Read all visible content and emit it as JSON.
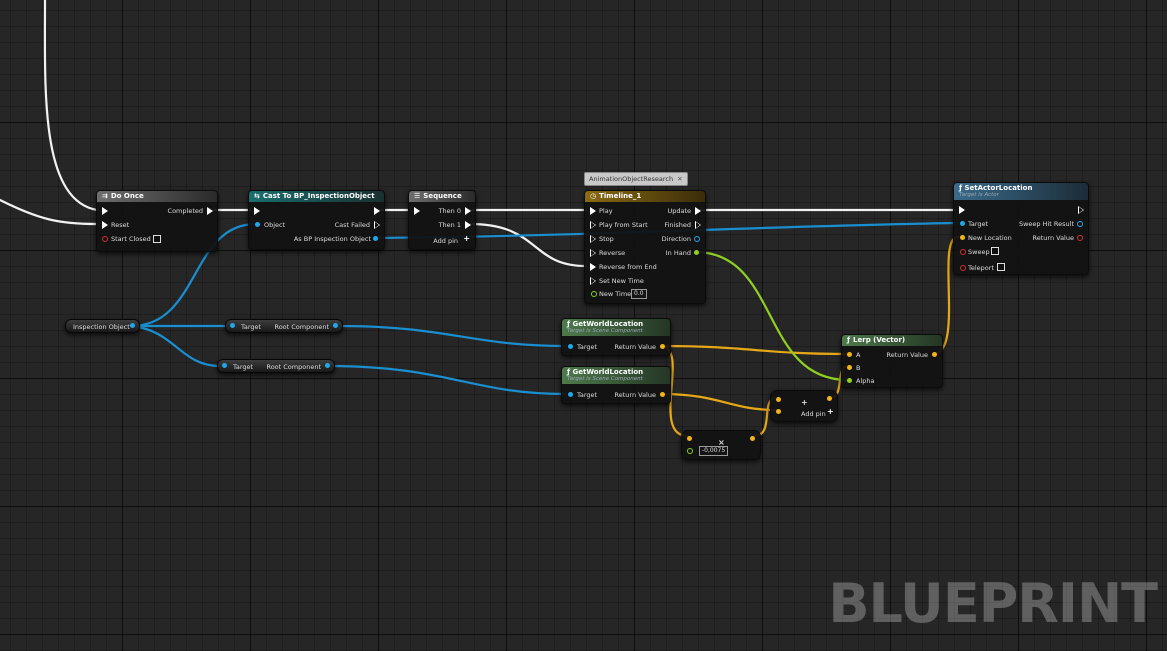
{
  "watermark": "BLUEPRINT",
  "comment_bubble": "AnimationObjectResearch",
  "nodes": {
    "do_once": {
      "title": "Do Once",
      "in_exec": "",
      "completed": "Completed",
      "reset": "Reset",
      "start_closed": "Start Closed"
    },
    "cast": {
      "title": "Cast To BP_InspectionObject",
      "object": "Object",
      "cast_failed": "Cast Failed",
      "as_obj": "As BP Inspection Object"
    },
    "sequence": {
      "title": "Sequence",
      "then0": "Then 0",
      "then1": "Then 1",
      "add_pin": "Add pin"
    },
    "timeline": {
      "title": "Timeline_1",
      "play": "Play",
      "play_from_start": "Play from Start",
      "stop": "Stop",
      "reverse": "Reverse",
      "reverse_from_end": "Reverse from End",
      "set_new_time": "Set New Time",
      "new_time": "New Time",
      "new_time_value": "0.0",
      "update": "Update",
      "finished": "Finished",
      "direction": "Direction",
      "in_hand": "In Hand"
    },
    "set_actor_location": {
      "title": "SetActorLocation",
      "subtitle": "Target is Actor",
      "target": "Target",
      "new_location": "New Location",
      "sweep": "Sweep",
      "teleport": "Teleport",
      "sweep_hit_result": "Sweep Hit Result",
      "return_value": "Return Value"
    },
    "inspection_object": {
      "label": "Inspection Object"
    },
    "root_comp_1": {
      "target": "Target",
      "value": "Root Component"
    },
    "root_comp_2": {
      "target": "Target",
      "value": "Root Component"
    },
    "get_world_loc_1": {
      "title": "GetWorldLocation",
      "subtitle": "Target is Scene Component",
      "target": "Target",
      "return_value": "Return Value"
    },
    "get_world_loc_2": {
      "title": "GetWorldLocation",
      "subtitle": "Target is Scene Component",
      "target": "Target",
      "return_value": "Return Value"
    },
    "lerp": {
      "title": "Lerp (Vector)",
      "a": "A",
      "b": "B",
      "alpha": "Alpha",
      "return_value": "Return Value"
    },
    "add": {
      "symbol": "+",
      "add_pin": "Add pin"
    },
    "multiply": {
      "symbol": "×",
      "value": "-0,0075"
    }
  },
  "colors": {
    "exec": "#ffffff",
    "object": "#1ea8ea",
    "vector": "#f1b51a",
    "float": "#8fcf21",
    "bool": "#c41a1a"
  }
}
